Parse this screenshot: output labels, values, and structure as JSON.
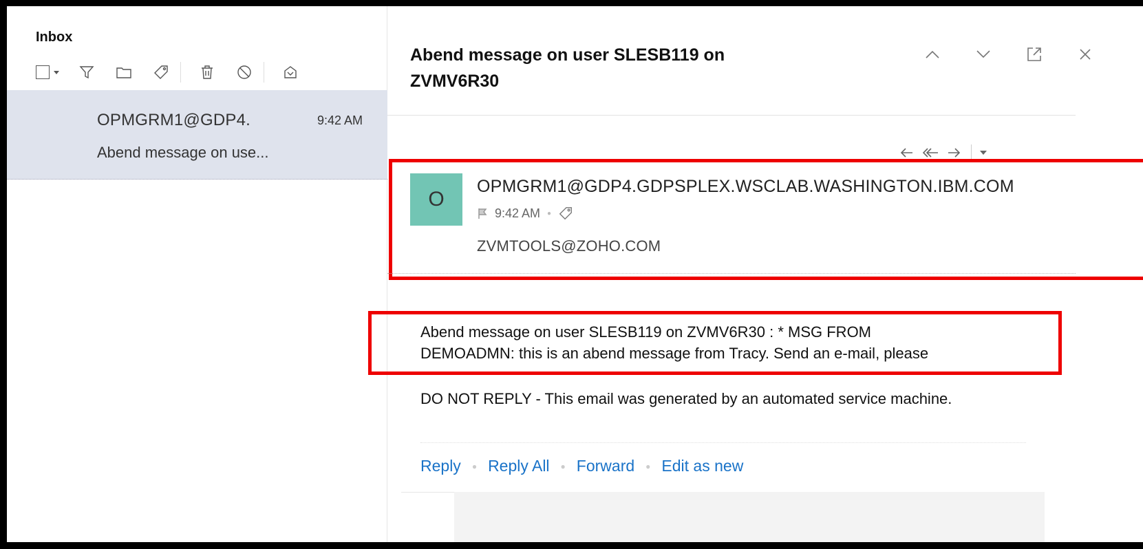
{
  "list": {
    "title": "Inbox",
    "toolbar": [
      "select-checkbox",
      "filter-icon",
      "folder-icon",
      "tag-icon",
      "delete-icon",
      "block-icon",
      "snooze-icon"
    ],
    "items": [
      {
        "from": "OPMGRM1@GDP4.",
        "time": "9:42 AM",
        "subject": "Abend message on use..."
      }
    ]
  },
  "reader": {
    "subject": "Abend message on user SLESB119 on ZVMV6R30",
    "header_icons": [
      "chevron-up-icon",
      "chevron-down-icon",
      "pop-out-icon",
      "close-icon"
    ],
    "action_icons": [
      "reply-icon",
      "reply-all-icon",
      "forward-icon",
      "more-dropdown-icon"
    ],
    "avatar_letter": "O",
    "sender": "OPMGRM1@GDP4.GDPSPLEX.WSCLAB.WASHINGTON.IBM.COM",
    "time": "9:42 AM",
    "recipient": "ZVMTOOLS@ZOHO.COM",
    "body_line1": "Abend message on user SLESB119 on ZVMV6R30 : * MSG FROM",
    "body_line2": "DEMOADMN: this is an abend message from Tracy. Send an e-mail, please",
    "footer": "DO NOT REPLY - This email was generated by an automated service machine.",
    "links": {
      "reply": "Reply",
      "reply_all": "Reply All",
      "forward": "Forward",
      "edit_as_new": "Edit as new"
    }
  },
  "colors": {
    "highlight": "#e00000",
    "avatar": "#72c5b4",
    "selected_row": "#dfe3ed",
    "link": "#1a73c8"
  }
}
